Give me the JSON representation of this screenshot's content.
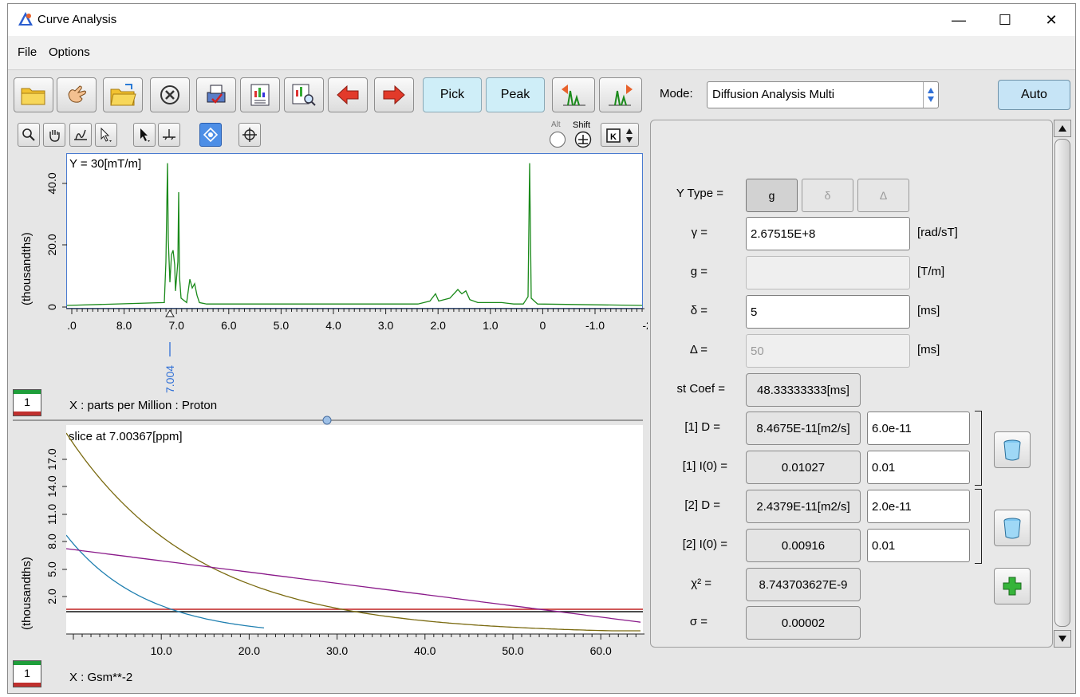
{
  "window": {
    "title": "Curve Analysis",
    "minimize": "—",
    "maximize": "☐",
    "close": "✕"
  },
  "menu": {
    "file": "File",
    "options": "Options"
  },
  "toolbar": {
    "pick": "Pick",
    "peak": "Peak",
    "auto": "Auto"
  },
  "mode": {
    "label": "Mode:",
    "value": "Diffusion Analysis Multi"
  },
  "keys": {
    "alt": "Alt",
    "shift": "Shift"
  },
  "top_plot": {
    "annotation": "Y = 30[mT/m]",
    "ylabel": "(thousandths)",
    "yticks": [
      "40.0",
      "20.0",
      "0"
    ],
    "xticks": [
      ".0",
      "8.0",
      "7.0",
      "6.0",
      "5.0",
      "4.0",
      "3.0",
      "2.0",
      "1.0",
      "0",
      "-1.0",
      "-2"
    ],
    "xlabel": "X : parts per Million : Proton",
    "cursor_label": "7.004",
    "slice_index": "1"
  },
  "bottom_plot": {
    "annotation": "slice at 7.00367[ppm]",
    "ylabel": "(thousandths)",
    "yticks": [
      "17.0",
      "14.0",
      "11.0",
      "8.0",
      "5.0",
      "2.0"
    ],
    "xticks": [
      "10.0",
      "20.0",
      "30.0",
      "40.0",
      "50.0",
      "60.0"
    ],
    "xlabel": "X : Gsm**-2",
    "slice_index": "1"
  },
  "params": {
    "ytype_label": "Y Type =",
    "ytype_options": [
      "g",
      "δ",
      "Δ"
    ],
    "gamma_label": "γ =",
    "gamma_value": "2.67515E+8",
    "gamma_unit": "[rad/sT]",
    "g_label": "g =",
    "g_value": "",
    "g_unit": "[T/m]",
    "delta_label": "δ =",
    "delta_value": "5",
    "delta_unit": "[ms]",
    "Delta_label": "Δ =",
    "Delta_value": "50",
    "Delta_unit": "[ms]",
    "stcoef_label": "st Coef =",
    "stcoef_value": "48.33333333[ms]",
    "d1_label": "[1] D =",
    "d1_value": "8.4675E-11[m2/s]",
    "d1_input": "6.0e-11",
    "i1_label": "[1] I(0) =",
    "i1_value": "0.01027",
    "i1_input": "0.01",
    "d2_label": "[2] D =",
    "d2_value": "2.4379E-11[m2/s]",
    "d2_input": "2.0e-11",
    "i2_label": "[2] I(0) =",
    "i2_value": "0.00916",
    "i2_input": "0.01",
    "chi_label": "χ² =",
    "chi_value": "8.743703627E-9",
    "sigma_label": "σ =",
    "sigma_value": "0.00002"
  },
  "colors": {
    "spectrum": "#1a8a1a",
    "fit_total": "#7a6a10",
    "fit_comp1": "#1f7fb0",
    "fit_comp2": "#8a1a8a",
    "accent": "#2f6fd6"
  }
}
